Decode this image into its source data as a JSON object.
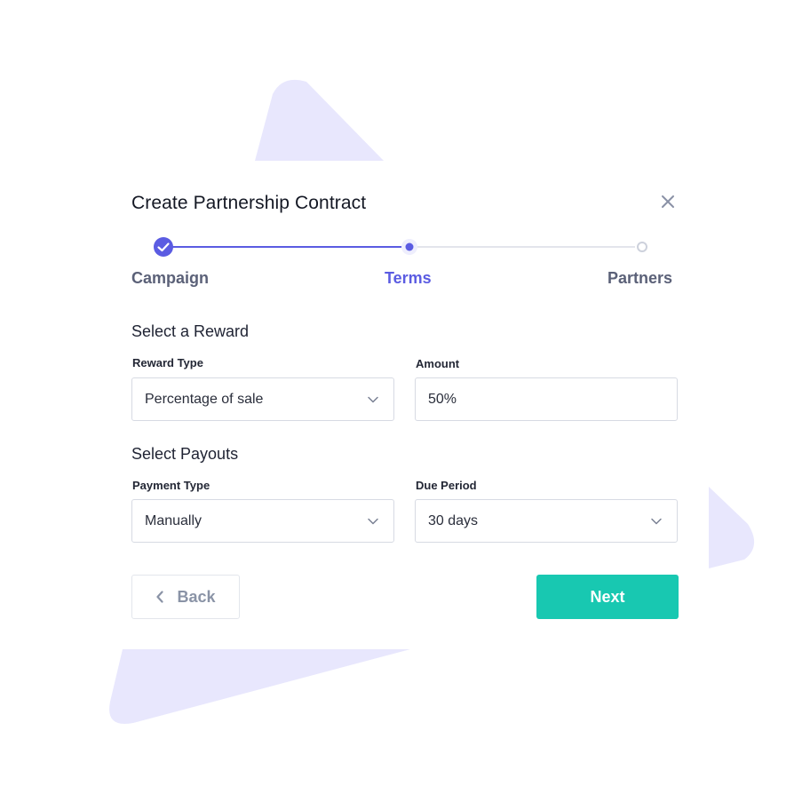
{
  "modal": {
    "title": "Create Partnership Contract",
    "close_icon": "close-icon"
  },
  "stepper": {
    "steps": [
      {
        "label": "Campaign",
        "state": "completed"
      },
      {
        "label": "Terms",
        "state": "active"
      },
      {
        "label": "Partners",
        "state": "upcoming"
      }
    ]
  },
  "reward": {
    "section_title": "Select a Reward",
    "type_label": "Reward Type",
    "type_value": "Percentage of sale",
    "amount_label": "Amount",
    "amount_value": "50%"
  },
  "payouts": {
    "section_title": "Select Payouts",
    "payment_type_label": "Payment Type",
    "payment_type_value": "Manually",
    "due_period_label": "Due Period",
    "due_period_value": "30 days"
  },
  "actions": {
    "back_label": "Back",
    "next_label": "Next"
  },
  "colors": {
    "accent": "#5b5ce2",
    "primary_button": "#18c8b1",
    "decor": "#e8e7fd"
  }
}
